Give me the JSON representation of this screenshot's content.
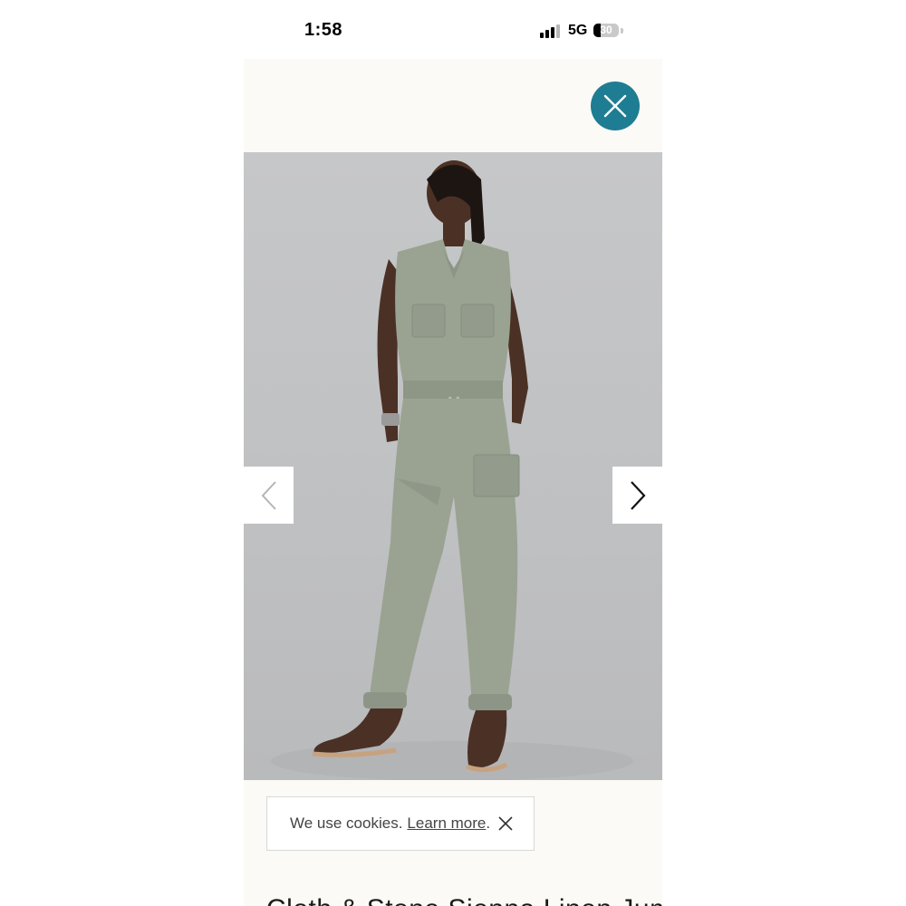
{
  "status_bar": {
    "time": "1:58",
    "network": "5G",
    "battery_percent": "30",
    "battery_level": 0.3,
    "signal_bars": 3
  },
  "modal": {
    "close_icon": "close-icon",
    "accent_color": "#1e7d92",
    "prev_icon": "chevron-left-icon",
    "next_icon": "chevron-right-icon"
  },
  "cookie_banner": {
    "message": "We use cookies.",
    "link_label": "Learn more",
    "period": ".",
    "close_icon": "close-icon"
  },
  "product": {
    "title": "Cloth & Stone Sienna Linen Jumpsuit"
  }
}
